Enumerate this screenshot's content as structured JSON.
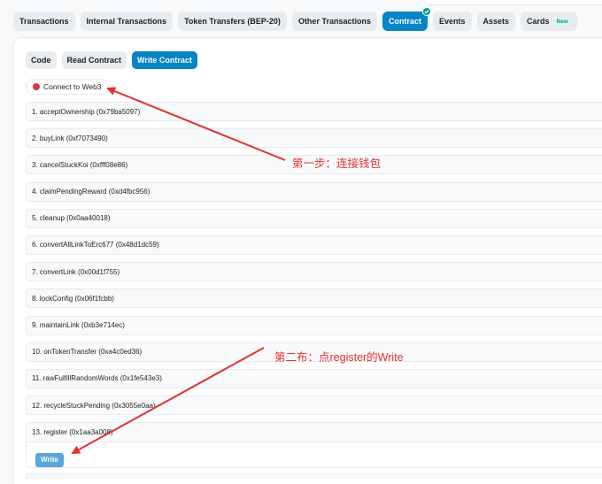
{
  "tabs": [
    {
      "label": "Transactions",
      "active": false
    },
    {
      "label": "Internal Transactions",
      "active": false
    },
    {
      "label": "Token Transfers (BEP-20)",
      "active": false
    },
    {
      "label": "Other Transactions",
      "active": false
    },
    {
      "label": "Contract",
      "active": true
    },
    {
      "label": "Events",
      "active": false
    },
    {
      "label": "Assets",
      "active": false
    },
    {
      "label": "Cards",
      "active": false,
      "badge": "New"
    }
  ],
  "subtabs": [
    {
      "label": "Code",
      "active": false
    },
    {
      "label": "Read Contract",
      "active": false
    },
    {
      "label": "Write Contract",
      "active": true
    }
  ],
  "connect": {
    "label": "Connect to Web3",
    "status_color": "#dc3545"
  },
  "functions": [
    "1. acceptOwnership (0x79ba5097)",
    "2. buyLink (0xf7073490)",
    "3. cancelStuckKoi (0xfff08e86)",
    "4. claimPendingReward (0xd4fbc956)",
    "5. cleanup (0x0aa40018)",
    "6. convertAllLinkToErc677 (0x48d1dc59)",
    "7. convertLink (0x00d1f755)",
    "8. lockConfig (0x06f1fcbb)",
    "9. maintainLink (0xb3e714ec)",
    "10. onTokenTransfer (0xa4c0ed36)",
    "11. rawFulfillRandomWords (0x1fe543e3)",
    "12. recycleStuckPending (0x3055e0aa)"
  ],
  "open_function": {
    "label": "13. register (0x1aa3a008)",
    "write_label": "Write"
  },
  "annotations": {
    "step1": "第一步：连接钱包",
    "step2": "第二布：点register的Write"
  },
  "colors": {
    "accent": "#0784c3",
    "annotation": "#e03131",
    "new_badge": "#00a186"
  }
}
